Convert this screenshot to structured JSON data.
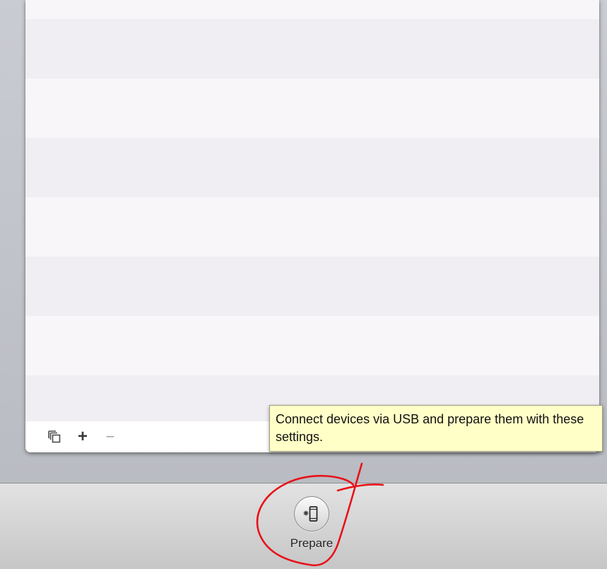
{
  "settings_list": {
    "row_count": 8
  },
  "list_footer": {
    "copy_icon": "duplicate-icon",
    "add_label": "+",
    "remove_label": "−"
  },
  "tooltip": {
    "text": "Connect devices via USB and prepare them with these settings."
  },
  "toolbar": {
    "prepare_icon": "device-prepare-icon",
    "prepare_label": "Prepare"
  },
  "annotation": {
    "stroke_color": "#e8121a",
    "description_note": ""
  }
}
